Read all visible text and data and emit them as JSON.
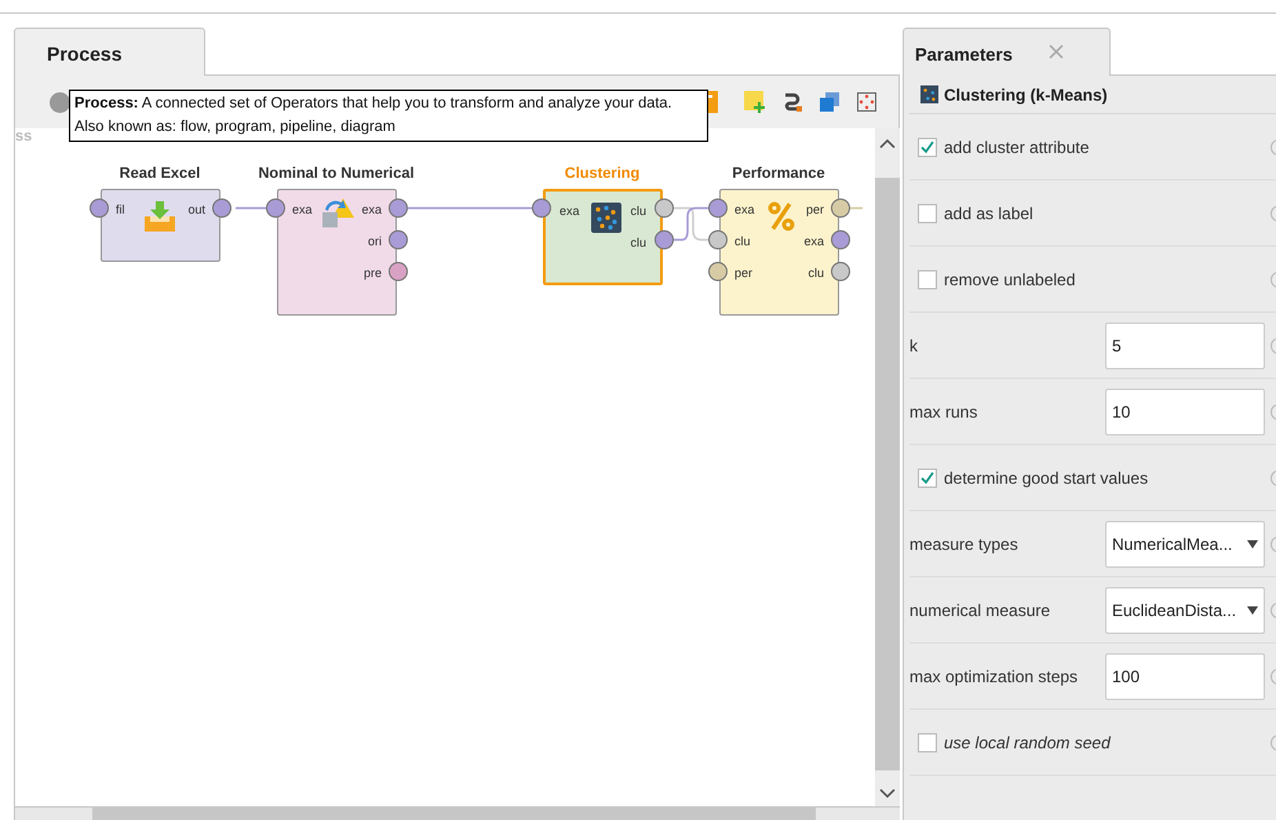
{
  "process_tab": {
    "label": "Process",
    "selected": true
  },
  "tooltip": {
    "text": "**Process:** A connected set of Operators that help you to transform and analyze your data.",
    "aliases": "Also known as: flow, program, pipeline, diagram"
  },
  "canvas_label": "ss",
  "operators": [
    {
      "title": "Read Excel",
      "selected": false,
      "color": "#dfdcee",
      "inputs": [
        {
          "label": "fil",
          "color": "#a99bd6"
        }
      ],
      "outputs": [
        {
          "label": "out",
          "color": "#a99bd6"
        }
      ]
    },
    {
      "title": "Nominal to Numerical",
      "selected": false,
      "color": "#f1dbe9",
      "inputs": [
        {
          "label": "exa",
          "color": "#a99bd6"
        }
      ],
      "outputs": [
        {
          "label": "exa",
          "color": "#a99bd6"
        },
        {
          "label": "ori",
          "color": "#a99bd6"
        },
        {
          "label": "pre",
          "color": "#d9a1c4"
        }
      ]
    },
    {
      "title": "Clustering",
      "selected": true,
      "color": "#d9e8d2",
      "inputs": [
        {
          "label": "exa",
          "color": "#a99bd6"
        }
      ],
      "outputs": [
        {
          "label": "clu",
          "color": "#c8c8c8"
        },
        {
          "label": "clu",
          "color": "#a99bd6"
        }
      ]
    },
    {
      "title": "Performance",
      "selected": false,
      "color": "#fcf3cc",
      "inputs": [
        {
          "label": "exa",
          "color": "#a99bd6"
        },
        {
          "label": "clu",
          "color": "#c8c8c8"
        },
        {
          "label": "per",
          "color": "#d6cba4"
        }
      ],
      "outputs": [
        {
          "label": "per",
          "color": "#d6cba4"
        },
        {
          "label": "exa",
          "color": "#a99bd6"
        },
        {
          "label": "clu",
          "color": "#c8c8c8"
        }
      ]
    }
  ],
  "parameters_panel": {
    "tab": {
      "label": "Parameters",
      "selected": true
    },
    "operator": "Clustering (k-Means)",
    "rows": [
      {
        "kind": "checkbox",
        "label": "add cluster attribute",
        "checked": true,
        "expert": false
      },
      {
        "kind": "checkbox",
        "label": "add as label",
        "checked": false,
        "expert": false
      },
      {
        "kind": "checkbox",
        "label": "remove unlabeled",
        "checked": false,
        "expert": false
      },
      {
        "kind": "text",
        "label": "k",
        "value": "5",
        "expert": false
      },
      {
        "kind": "text",
        "label": "max runs",
        "value": "10",
        "expert": false
      },
      {
        "kind": "checkbox",
        "label": "determine good start values",
        "checked": true,
        "expert": false
      },
      {
        "kind": "dropdown",
        "label": "measure types",
        "value": "NumericalMea...",
        "expert": false
      },
      {
        "kind": "dropdown",
        "label": "numerical measure",
        "value": "EuclideanDista...",
        "expert": false
      },
      {
        "kind": "text",
        "label": "max optimization steps",
        "value": "100",
        "expert": false
      },
      {
        "kind": "checkbox",
        "label": "use local random seed",
        "checked": false,
        "expert": true
      }
    ]
  }
}
